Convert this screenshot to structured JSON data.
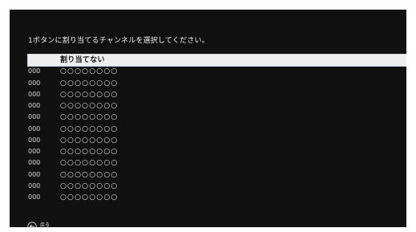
{
  "title": "1ボタンに割り当てるチャンネルを選択してください。",
  "channels": [
    {
      "number": "",
      "name": "割り当てない"
    },
    {
      "number": "000",
      "name": "○○○○○○○○"
    },
    {
      "number": "000",
      "name": "○○○○○○○○"
    },
    {
      "number": "000",
      "name": "○○○○○○○○"
    },
    {
      "number": "000",
      "name": "○○○○○○○○"
    },
    {
      "number": "000",
      "name": "○○○○○○○○"
    },
    {
      "number": "000",
      "name": "○○○○○○○○"
    },
    {
      "number": "000",
      "name": "○○○○○○○○"
    },
    {
      "number": "000",
      "name": "○○○○○○○○"
    },
    {
      "number": "000",
      "name": "○○○○○○○○"
    },
    {
      "number": "000",
      "name": "○○○○○○○○"
    },
    {
      "number": "000",
      "name": "○○○○○○○○"
    },
    {
      "number": "000",
      "name": "○○○○○○○○"
    }
  ],
  "footer": {
    "back_label": "戻る",
    "back_icon": "back-arrow-icon"
  },
  "colors": {
    "screen_background": "#111111",
    "selected_background": "#eeeeee",
    "text": "#eaeaea"
  }
}
